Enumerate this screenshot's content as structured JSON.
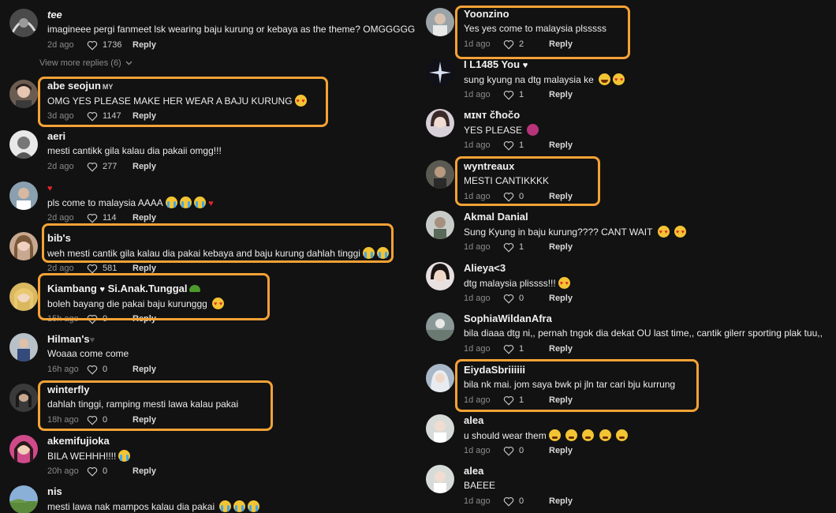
{
  "view_more_label": "View more replies (6)",
  "reply_label": "Reply",
  "left": [
    {
      "user": "tee",
      "text": "imagineee pergi fanmeet lsk wearing baju kurung or kebaya as the theme? OMGGGGG",
      "date": "2d ago",
      "likes": "1736"
    },
    {
      "user": "abe seojun",
      "tag": "MY",
      "text": "OMG YES PLEASE MAKE HER WEAR A BAJU KURUNG",
      "date": "3d ago",
      "likes": "1147"
    },
    {
      "user": "aeri",
      "text": "mesti cantikk gila kalau dia pakaii omgg!!!",
      "date": "2d ago",
      "likes": "277"
    },
    {
      "user": "",
      "text": "pls come to malaysia AAAA",
      "date": "2d ago",
      "likes": "114"
    },
    {
      "user": "bib's",
      "text": "weh mesti cantik gila kalau dia pakai kebaya and baju kurung dahlah tinggi",
      "date": "2d ago",
      "likes": "581"
    },
    {
      "user": "Kiambang",
      "user2": "Si.Anak.Tunggal",
      "text": "boleh bayang die pakai baju kurunggg",
      "date": "15h ago",
      "likes": "0"
    },
    {
      "user": "Hilman's",
      "text": "Woaaa come come",
      "date": "16h ago",
      "likes": "0"
    },
    {
      "user": "winterfly",
      "text": "dahlah tinggi, ramping mesti lawa kalau pakai",
      "date": "18h ago",
      "likes": "0"
    },
    {
      "user": "akemifujioka",
      "text": "BILA WEHHH!!!!",
      "date": "20h ago",
      "likes": "0"
    },
    {
      "user": "nis",
      "text": "mesti lawa nak mampos kalau dia pakai",
      "date": "",
      "likes": ""
    }
  ],
  "right": [
    {
      "user": "Yoonzino",
      "text": "Yes yes come to malaysia plsssss",
      "date": "1d ago",
      "likes": "2"
    },
    {
      "user": "I L1485 You",
      "text": "sung kyung na dtg malaysia ke",
      "date": "1d ago",
      "likes": "1"
    },
    {
      "user": "ᴍɪɴᴛ čħočo",
      "text": "YES PLEASE",
      "date": "1d ago",
      "likes": "1"
    },
    {
      "user": "wyntreaux",
      "text": "MESTI CANTIKKKK",
      "date": "1d ago",
      "likes": "0"
    },
    {
      "user": "Akmal Danial",
      "text": "Sung Kyung in baju kurung???? CANT WAIT",
      "date": "1d ago",
      "likes": "1"
    },
    {
      "user": "Alieya<3",
      "text": "dtg malaysia plissss!!!",
      "date": "1d ago",
      "likes": "0"
    },
    {
      "user": "SophiaWildanAfra",
      "text": "bila diaaa dtg ni,, pernah tngok dia dekat OU last time,, cantik gilerr sporting plak tuu,,",
      "date": "1d ago",
      "likes": "1"
    },
    {
      "user": "EiydaSbriiiiii",
      "text": "bila nk mai. jom saya bwk pi jln tar cari bju kurrung",
      "date": "1d ago",
      "likes": "1"
    },
    {
      "user": "alea",
      "text": "u should wear them",
      "date": "1d ago",
      "likes": "0"
    },
    {
      "user": "alea",
      "text": "BAEEE",
      "date": "1d ago",
      "likes": "0"
    }
  ],
  "colors": {
    "highlight": "#f4a236",
    "background": "#121212",
    "heart_red": "#e0242b"
  }
}
